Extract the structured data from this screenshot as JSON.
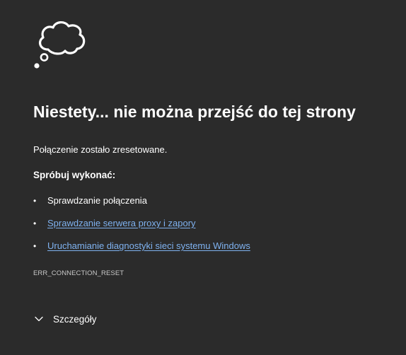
{
  "error_page": {
    "icon": "thought-cloud-icon",
    "title": "Niestety... nie można przejść do tej strony",
    "message": "Połączenie zostało zresetowane.",
    "try_heading": "Spróbuj wykonać:",
    "suggestions": [
      {
        "label": "Sprawdzanie połączenia",
        "is_link": false
      },
      {
        "label": "Sprawdzanie serwera proxy i zapory",
        "is_link": true
      },
      {
        "label": "Uruchamianie diagnostyki sieci systemu Windows",
        "is_link": true
      }
    ],
    "error_code": "ERR_CONNECTION_RESET",
    "details_label": "Szczegóły",
    "details_icon": "chevron-down-icon"
  },
  "colors": {
    "background": "#2b2b2b",
    "text": "#ffffff",
    "link": "#7fb2f0",
    "muted": "#c8c8c8"
  }
}
